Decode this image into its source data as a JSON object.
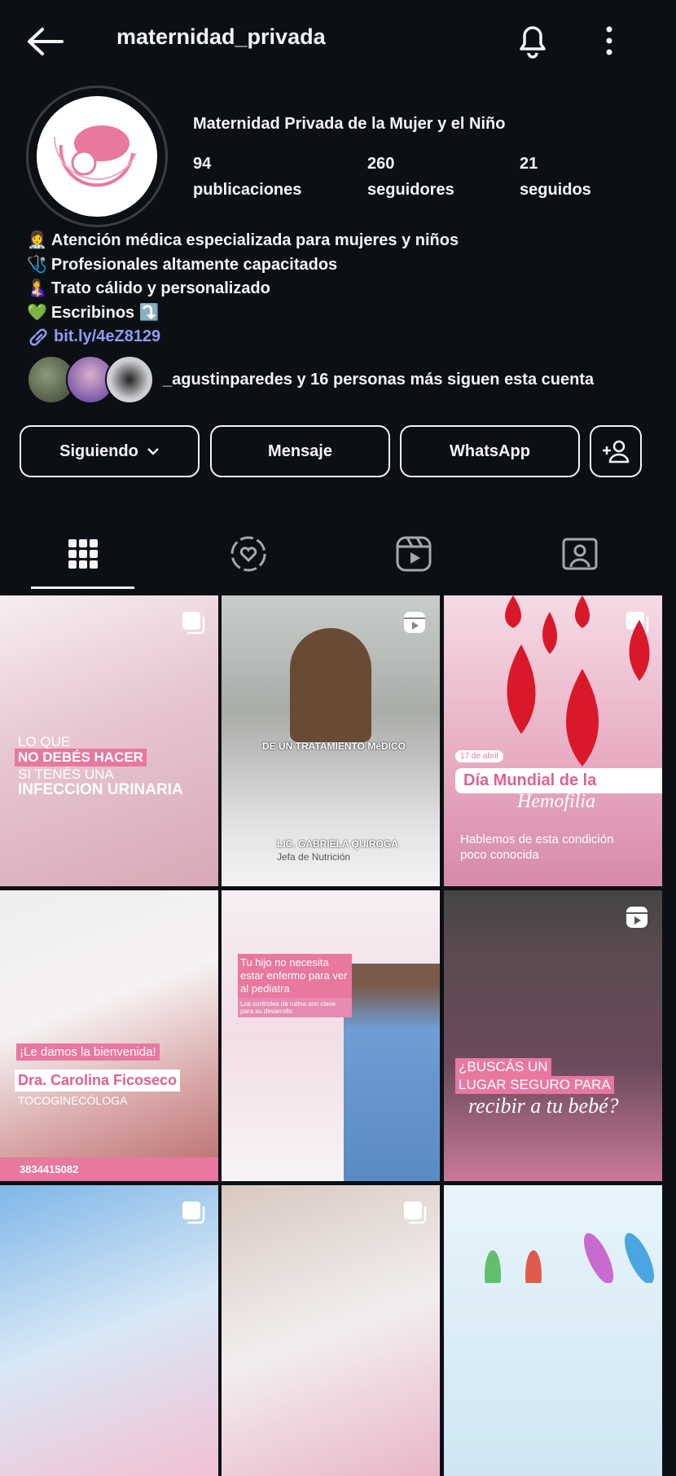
{
  "header": {
    "username": "maternidad_privada"
  },
  "profile": {
    "display_name": "Maternidad Privada de la Mujer y el Niño",
    "stats": [
      {
        "value": "94",
        "label": "publicaciones"
      },
      {
        "value": "260",
        "label": "seguidores"
      },
      {
        "value": "21",
        "label": "seguidos"
      }
    ],
    "bio": [
      {
        "emoji": "👩‍⚕️",
        "text": "Atención médica especializada para mujeres y niños"
      },
      {
        "emoji": "🩺",
        "text": "Profesionales altamente capacitados"
      },
      {
        "emoji": "🤱",
        "text": "Trato cálido y personalizado"
      },
      {
        "emoji": "💚",
        "text": "Escribinos ⤵️"
      }
    ],
    "link": "bit.ly/4eZ8129",
    "followed_by": "_agustinparedes y 16 personas más siguen esta cuenta"
  },
  "actions": {
    "following": "Siguiendo",
    "message": "Mensaje",
    "whatsapp": "WhatsApp"
  },
  "colors": {
    "background": "#0c1014",
    "link": "#8c9cf5",
    "brand_pink": "#e8789f"
  },
  "posts": [
    {
      "type": "carousel",
      "lines": [
        "LO QUE",
        "NO DEBÉS HACER",
        "SI TENÉS UNA",
        "INFECCION URINARIA"
      ]
    },
    {
      "type": "reel",
      "lines": [
        "DE UN TRATAMIENTO MéDICO",
        "LIC. GABRIELA QUIROGA",
        "Jefa de Nutrición"
      ]
    },
    {
      "type": "carousel",
      "lines": [
        "17 de abril",
        "Día Mundial de la",
        "Hemofilia",
        "Hablemos de esta condición poco conocida"
      ]
    },
    {
      "type": "image",
      "lines": [
        "¡Le damos la bienvenida!",
        "Dra. Carolina Ficoseco",
        "TOCOGINECÓLOGA",
        "3834415082"
      ]
    },
    {
      "type": "image",
      "lines": [
        "Tu hijo no necesita estar enfermo para ver al pediatra",
        "Los controles de rutina son clave para su desarrollo"
      ]
    },
    {
      "type": "reel",
      "lines": [
        "¿BUSCÁS UN",
        "LUGAR SEGURO PARA",
        "recibir a tu bebé?"
      ]
    },
    {
      "type": "carousel",
      "lines": []
    },
    {
      "type": "carousel",
      "lines": []
    },
    {
      "type": "image",
      "lines": []
    }
  ]
}
